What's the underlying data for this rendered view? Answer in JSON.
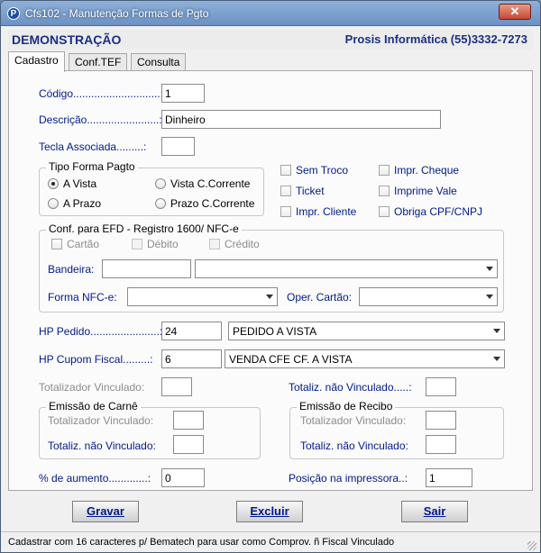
{
  "window": {
    "title": "Cfs102 - Manutenção Formas de Pgto",
    "icon_letter": "P",
    "close_glyph": "✕"
  },
  "header": {
    "company_left": "DEMONSTRAÇÃO",
    "company_right": "Prosis Informática (55)3332-7273"
  },
  "tabs": [
    {
      "label": "Cadastro",
      "active": true
    },
    {
      "label": "Conf.TEF",
      "active": false
    },
    {
      "label": "Consulta",
      "active": false
    }
  ],
  "form": {
    "codigo": {
      "label": "Código.............................:",
      "value": "1"
    },
    "descricao": {
      "label": "Descrição........................:",
      "value": "Dinheiro"
    },
    "tecla": {
      "label": "Tecla Associada.........:",
      "value": ""
    },
    "tipo_forma": {
      "title": "Tipo Forma Pagto",
      "options": [
        "A Vista",
        "A Prazo",
        "Vista C.Corrente",
        "Prazo C.Corrente"
      ],
      "selected": "A Vista"
    },
    "checks": {
      "sem_troco": "Sem Troco",
      "impr_cheque": "Impr. Cheque",
      "ticket": "Ticket",
      "imprime_vale": "Imprime Vale",
      "impr_cliente": "Impr. Cliente",
      "obriga_cpf": "Obriga CPF/CNPJ"
    },
    "efd": {
      "title": "Conf. para EFD - Registro 1600/ NFC-e",
      "cartao": "Cartão",
      "debito": "Débito",
      "credito": "Crédito",
      "bandeira_label": "Bandeira:",
      "forma_label": "Forma  NFC-e:",
      "oper_label": "Oper. Cartão:"
    },
    "hp_pedido": {
      "label": "HP Pedido.......................:",
      "code": "24",
      "desc": "PEDIDO A VISTA"
    },
    "hp_cupom": {
      "label": "HP Cupom Fiscal.........:",
      "code": "6",
      "desc": "VENDA CFE CF. A VISTA"
    },
    "totalizador_vinc": {
      "label": "Totalizador Vinculado:"
    },
    "totaliz_nao_vinc": {
      "label": "Totaliz. não Vinculado.....:"
    },
    "carne": {
      "title": "Emissão de Carnê",
      "tot_label": "Totalizador Vinculado:",
      "nao_label": "Totaliz. não Vinculado:"
    },
    "recibo": {
      "title": "Emissão de Recibo",
      "tot_label": "Totalizador Vinculado:",
      "nao_label": "Totaliz. não Vinculado:"
    },
    "aumento": {
      "label": "%  de aumento.............:",
      "value": "0"
    },
    "posicao": {
      "label": "Posição na impressora..:",
      "value": "1"
    }
  },
  "buttons": {
    "gravar": "Gravar",
    "excluir": "Excluir",
    "sair": "Sair"
  },
  "status": "Cadastrar com 16 caracteres p/ Bematech para usar como Comprov. ñ Fiscal Vinculado"
}
